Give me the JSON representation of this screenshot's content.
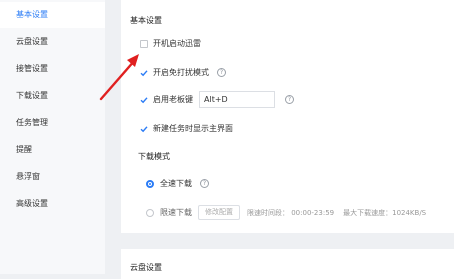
{
  "sidebar": {
    "items": [
      {
        "label": "基本设置"
      },
      {
        "label": "云盘设置"
      },
      {
        "label": "接管设置"
      },
      {
        "label": "下载设置"
      },
      {
        "label": "任务管理"
      },
      {
        "label": "提醒"
      },
      {
        "label": "悬浮窗"
      },
      {
        "label": "高级设置"
      }
    ]
  },
  "basic": {
    "title": "基本设置",
    "autostart_label": "开机启动迅雷",
    "autostart_checked": false,
    "no_disturb_label": "开启免打扰模式",
    "no_disturb_checked": true,
    "boss_key_label": "启用老板键",
    "boss_key_checked": true,
    "boss_key_value": "Alt+D",
    "show_main_label": "新建任务时显示主界面",
    "show_main_checked": true,
    "download_mode_title": "下载模式",
    "full_speed_label": "全速下载",
    "limit_speed_label": "限速下载",
    "edit_config_label": "修改配置",
    "limit_time_text": "限速时间段：  00:00-23:59",
    "max_speed_text": "最大下载速度：1024KB/S",
    "selected_mode": "全速下载",
    "help_glyph": "?"
  },
  "cloud": {
    "title": "云盘设置"
  },
  "colors": {
    "accent": "#2b7cf6",
    "arrow": "#e02020"
  }
}
